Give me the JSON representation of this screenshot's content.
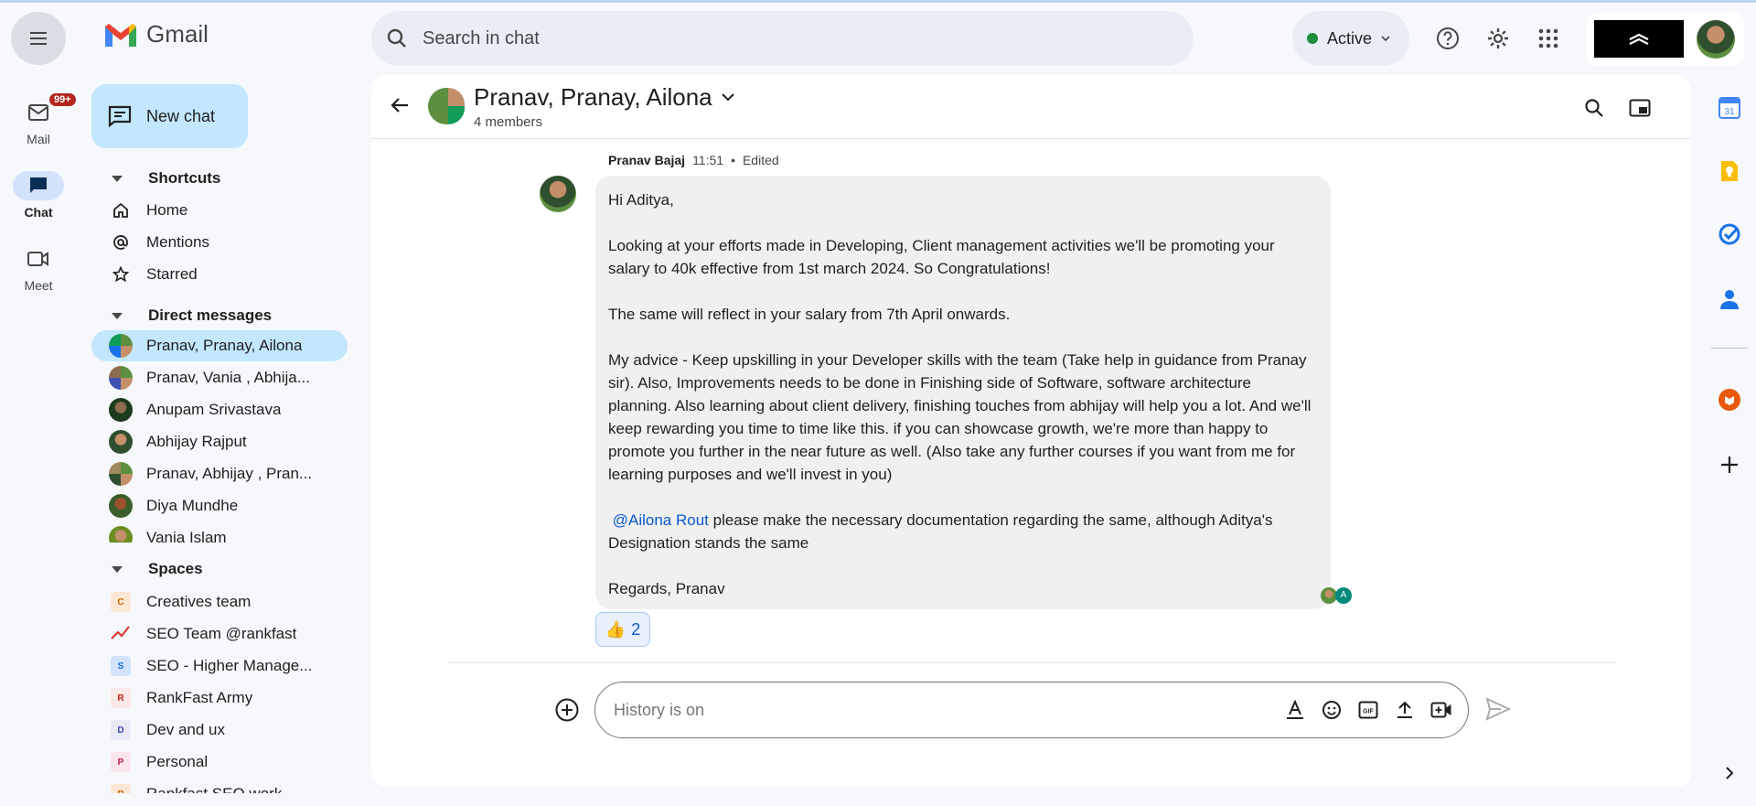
{
  "app": {
    "name": "Gmail"
  },
  "rail": {
    "mail_label": "Mail",
    "mail_badge": "99+",
    "chat_label": "Chat",
    "meet_label": "Meet"
  },
  "search": {
    "placeholder": "Search in chat"
  },
  "status": {
    "label": "Active",
    "color": "#1e8e3e"
  },
  "nav": {
    "new_chat": "New chat",
    "shortcuts_title": "Shortcuts",
    "shortcuts": [
      "Home",
      "Mentions",
      "Starred"
    ],
    "dm_title": "Direct messages",
    "dms": [
      "Pranav, Pranay, Ailona",
      "Pranav, Vania , Abhija...",
      "Anupam Srivastava",
      "Abhijay Rajput",
      "Pranav, Abhijay , Pran...",
      "Diya Mundhe",
      "Vania Islam"
    ],
    "spaces_title": "Spaces",
    "spaces": [
      {
        "letter": "C",
        "name": "Creatives team"
      },
      {
        "letter": "",
        "name": "SEO Team @rankfast"
      },
      {
        "letter": "S",
        "name": "SEO - Higher Manage..."
      },
      {
        "letter": "R",
        "name": "RankFast Army"
      },
      {
        "letter": "D",
        "name": "Dev and ux"
      },
      {
        "letter": "P",
        "name": "Personal"
      },
      {
        "letter": "R",
        "name": "Rankfast SEO work"
      }
    ]
  },
  "conversation": {
    "title": "Pranav, Pranay, Ailona",
    "members": "4 members",
    "sender": "Pranav Bajaj",
    "time": "11:51",
    "edited": "Edited",
    "greeting": "Hi Aditya,",
    "p1": "Looking at your efforts made in Developing, Client management activities we'll be promoting your salary to 40k effective from 1st march 2024. So Congratulations!",
    "p2": "The same will reflect in your salary from 7th April onwards.",
    "p3": "My advice - Keep upskilling in your Developer skills with the team (Take help in guidance from Pranay sir). Also, Improvements needs to be done in Finishing side of Software, software architecture planning. Also learning about client delivery, finishing touches from abhijay will help you a lot. And we'll keep rewarding you time to time like this. if you can showcase growth, we're more than happy to promote you further in the near future as well. (Also take any further courses if you want from me for learning purposes and we'll invest in you)",
    "mention": "@Ailona Rout",
    "p4_rest": " please make the necessary documentation regarding the same, although Aditya's Designation stands the same",
    "signoff": "Regards, Pranav",
    "read_letter": "A",
    "reaction_emoji": "👍",
    "reaction_count": "2"
  },
  "composer": {
    "placeholder": "History is on",
    "gif_label": "GIF"
  },
  "colors": {
    "accent": "#0b57d0",
    "selected": "#c2e7ff",
    "bubble": "#f0f0f0"
  }
}
